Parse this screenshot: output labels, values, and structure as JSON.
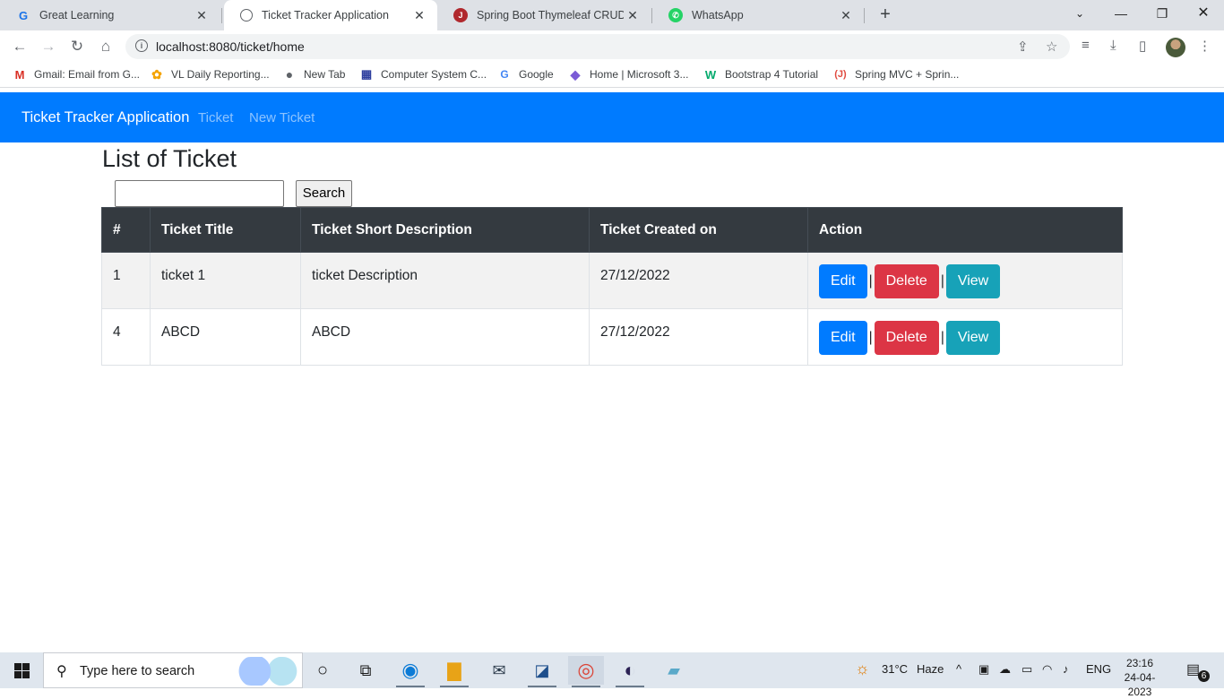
{
  "browser": {
    "tabs": [
      {
        "title": "Great Learning",
        "favicon": "G",
        "favicon_color": "#1a73e8",
        "active": false
      },
      {
        "title": "Ticket Tracker Application",
        "favicon": "globe",
        "favicon_color": "#5f6368",
        "active": true
      },
      {
        "title": "Spring Boot Thymeleaf CRUD Exa",
        "favicon": "J",
        "favicon_color": "#b0282d",
        "active": false
      },
      {
        "title": "WhatsApp",
        "favicon": "whatsapp",
        "favicon_color": "#25d366",
        "active": false
      }
    ],
    "new_tab_symbol": "+",
    "url": "localhost:8080/ticket/home",
    "bookmarks": [
      {
        "label": "Gmail: Email from G...",
        "icon": "gmail-icon"
      },
      {
        "label": "VL Daily Reporting...",
        "icon": "reporting-icon"
      },
      {
        "label": "New Tab",
        "icon": "globe-icon"
      },
      {
        "label": "Computer System C...",
        "icon": "building-icon"
      },
      {
        "label": "Google",
        "icon": "google-icon"
      },
      {
        "label": "Home | Microsoft 3...",
        "icon": "microsoft365-icon"
      },
      {
        "label": "Bootstrap 4 Tutorial",
        "icon": "w3schools-icon"
      },
      {
        "label": "Spring MVC + Sprin...",
        "icon": "javatpoint-icon"
      }
    ]
  },
  "app": {
    "brand": "Ticket Tracker Application",
    "nav_links": [
      "Ticket",
      "New Ticket"
    ],
    "navbar_color": "#007bff",
    "page_title": "List of Ticket",
    "search": {
      "value": "",
      "placeholder": "",
      "button_label": "Search"
    },
    "table": {
      "columns": [
        "#",
        "Ticket Title",
        "Ticket Short Description",
        "Ticket Created on",
        "Action"
      ],
      "rows": [
        {
          "id": "1",
          "title": "ticket 1",
          "description": "ticket Description",
          "created_on": "27/12/2022"
        },
        {
          "id": "4",
          "title": "ABCD",
          "description": "ABCD",
          "created_on": "27/12/2022"
        }
      ],
      "actions": {
        "edit": "Edit",
        "delete": "Delete",
        "view": "View",
        "separator": "|"
      },
      "action_colors": {
        "edit": "#007bff",
        "delete": "#dc3545",
        "view": "#17a2b8"
      }
    }
  },
  "taskbar": {
    "search_placeholder": "Type here to search",
    "weather": {
      "temp": "31°C",
      "condition": "Haze"
    },
    "language": "ENG",
    "time": "23:16",
    "date": "24-04-2023",
    "notification_count": "6"
  }
}
